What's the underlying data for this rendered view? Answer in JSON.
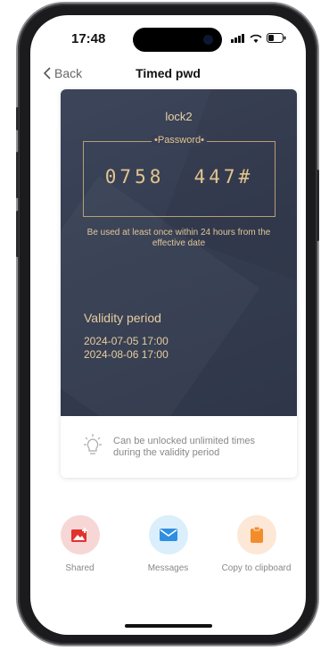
{
  "status_bar": {
    "time": "17:48"
  },
  "nav": {
    "back_label": "Back",
    "title": "Timed pwd"
  },
  "card": {
    "lock_name": "lock2",
    "password_label": "•Password•",
    "password_code": "0758  447#",
    "usage_note": "Be used at least once within 24 hours from the effective date",
    "validity_title": "Validity period",
    "validity_start": "2024-07-05 17:00",
    "validity_end": "2024-08-06 17:00",
    "tip": "Can be unlocked unlimited times during the validity period"
  },
  "actions": [
    {
      "label": "Shared",
      "icon": "shared-image-icon",
      "color": "#f7d6d6"
    },
    {
      "label": "Messages",
      "icon": "mail-icon",
      "color": "#daeefb"
    },
    {
      "label": "Copy to clipboard",
      "icon": "clipboard-icon",
      "color": "#fde7d6"
    }
  ],
  "colors": {
    "card_bg": "#363d52",
    "gold": "#e3c48e"
  }
}
